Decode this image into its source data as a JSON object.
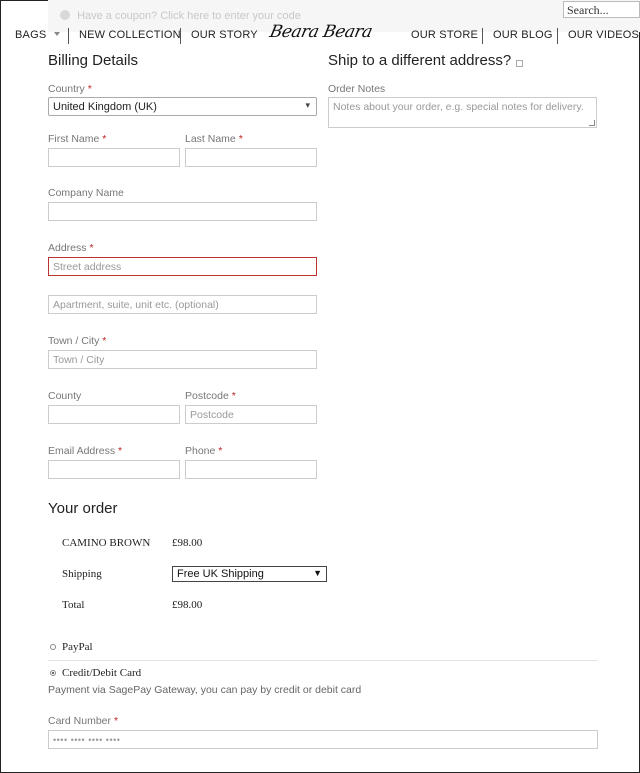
{
  "coupon": {
    "text": "Have a coupon? Click here to enter your code"
  },
  "search": {
    "placeholder": "Search..."
  },
  "nav": {
    "bags": "BAGS",
    "new_collection": "NEW COLLECTION",
    "our_story": "OUR STORY",
    "logo": "Beara Beara",
    "our_store": "OUR STORE",
    "our_blog": "OUR BLOG",
    "our_videos": "OUR VIDEOS"
  },
  "billing": {
    "title": "Billing Details",
    "country_label": "Country",
    "country_value": "United Kingdom (UK)",
    "first_name_label": "First Name",
    "last_name_label": "Last Name",
    "company_label": "Company Name",
    "address_label": "Address",
    "street_placeholder": "Street address",
    "apartment_placeholder": "Apartment, suite, unit etc. (optional)",
    "town_label": "Town / City",
    "town_placeholder": "Town / City",
    "county_label": "County",
    "postcode_label": "Postcode",
    "postcode_placeholder": "Postcode",
    "email_label": "Email Address",
    "phone_label": "Phone",
    "required_mark": "*"
  },
  "shipping": {
    "title": "Ship to a different address?",
    "notes_label": "Order Notes",
    "notes_placeholder": "Notes about your order, e.g. special notes for delivery."
  },
  "order": {
    "title": "Your order",
    "product_name": "CAMINO BROWN",
    "product_price": "£98.00",
    "shipping_label": "Shipping",
    "shipping_option": "Free UK Shipping",
    "total_label": "Total",
    "total_value": "£98.00"
  },
  "payment": {
    "paypal_label": "PayPal",
    "card_label": "Credit/Debit Card",
    "card_description": "Payment via SagePay Gateway, you can pay by credit or debit card",
    "card_number_label": "Card Number",
    "card_number_placeholder": "•••• •••• •••• ••••"
  }
}
